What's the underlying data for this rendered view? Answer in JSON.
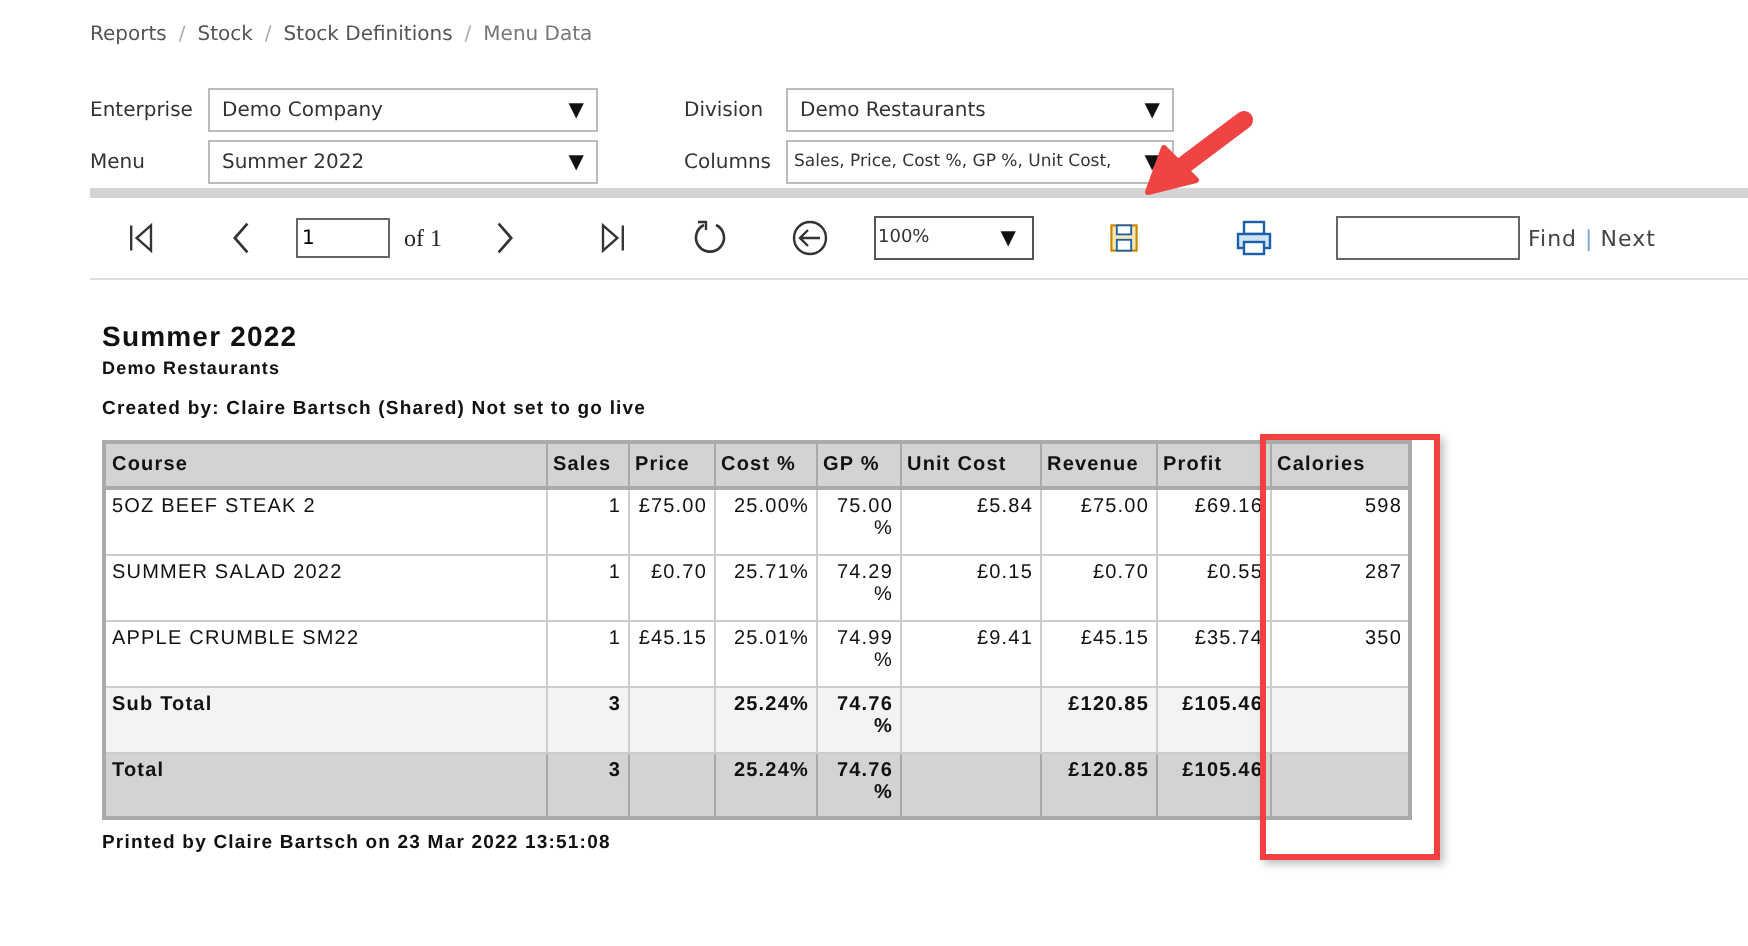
{
  "breadcrumb": [
    {
      "label": "Reports"
    },
    {
      "separator": "/",
      "label": "Stock"
    },
    {
      "separator": "/",
      "label": "Stock Definitions"
    },
    {
      "separator": "/",
      "label": "Menu Data"
    }
  ],
  "filters": [
    {
      "label": "Enterprise",
      "value": "Demo Company",
      "arrow": "▼"
    },
    {
      "label": "Division",
      "value": "Demo Restaurants",
      "arrow": "▼"
    },
    {
      "label": "Menu",
      "value": "Summer 2022",
      "arrow": "▼"
    },
    {
      "label": "Columns",
      "value": "Sales, Price, Cost %, GP %, Unit Cost,",
      "arrow": "▼"
    }
  ],
  "toolbar": {
    "page_value": "1",
    "page_count": "of 1",
    "zoom": "100%",
    "zoom_arrow": "▼",
    "find": "Find",
    "separator": "|",
    "next": "Next"
  },
  "report": {
    "title": "Summer 2022",
    "subtitle": "Demo Restaurants",
    "created": "Created by: Claire Bartsch (Shared) Not set to go live",
    "columns": [
      "Course",
      "Sales",
      "Price",
      "Cost %",
      "GP %",
      "Unit Cost",
      "Revenue",
      "Profit",
      "Calories"
    ],
    "rows": [
      {
        "kind": "item",
        "cells": [
          "5OZ BEEF STEAK 2",
          "1",
          "£75.00",
          "25.00%",
          "75.00 %",
          "£5.84",
          "£75.00",
          "£69.16",
          "598"
        ]
      },
      {
        "kind": "item",
        "cells": [
          "SUMMER SALAD 2022",
          "1",
          "£0.70",
          "25.71%",
          "74.29 %",
          "£0.15",
          "£0.70",
          "£0.55",
          "287"
        ]
      },
      {
        "kind": "item",
        "cells": [
          "APPLE CRUMBLE SM22",
          "1",
          "£45.15",
          "25.01%",
          "74.99 %",
          "£9.41",
          "£45.15",
          "£35.74",
          "350"
        ]
      },
      {
        "kind": "subtotal",
        "cells": [
          "Sub Total",
          "3",
          "",
          "25.24%",
          "74.76 %",
          "",
          "£120.85",
          "£105.46",
          ""
        ]
      },
      {
        "kind": "total",
        "cells": [
          "Total",
          "3",
          "",
          "25.24%",
          "74.76 %",
          "",
          "£120.85",
          "£105.46",
          ""
        ]
      }
    ],
    "printed": "Printed by Claire Bartsch on 23 Mar 2022 13:51:08"
  }
}
